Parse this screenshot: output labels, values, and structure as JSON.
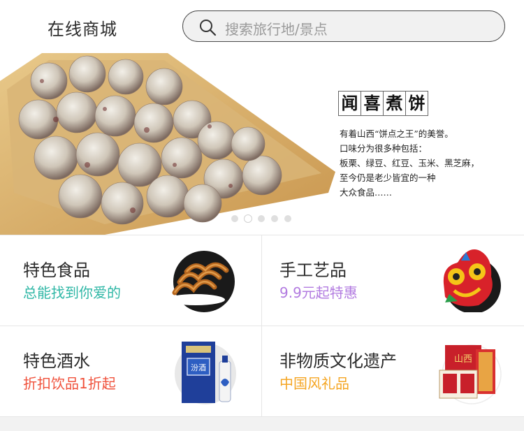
{
  "header": {
    "title": "在线商城",
    "search_placeholder": "搜索旅行地/景点",
    "search_icon": "search-icon"
  },
  "banner": {
    "heading_chars": [
      "闻",
      "喜",
      "煮",
      "饼"
    ],
    "description": "有着山西“饼点之王”的美誉。\n口味分为很多种包括：\n板栗、绿豆、红豆、玉米、黑芝麻，\n至今仍是老少皆宜的一种\n大众食品……",
    "dots": {
      "count": 5,
      "active_index": 1
    }
  },
  "categories": [
    {
      "name": "特色食品",
      "subtitle": "总能找到你爱的",
      "subtitle_color": "#2fb7a6",
      "image": "fried-dough-twist-image"
    },
    {
      "name": "手工艺品",
      "subtitle": "9.9元起特惠",
      "subtitle_color": "#b27be0",
      "image": "tiger-toy-image"
    },
    {
      "name": "特色酒水",
      "subtitle": "折扣饮品1折起",
      "subtitle_color": "#f0513b",
      "image": "liquor-bottle-image"
    },
    {
      "name": "非物质文化遗产",
      "subtitle": "中国风礼品",
      "subtitle_color": "#f5a623",
      "image": "paper-cut-book-image"
    }
  ]
}
